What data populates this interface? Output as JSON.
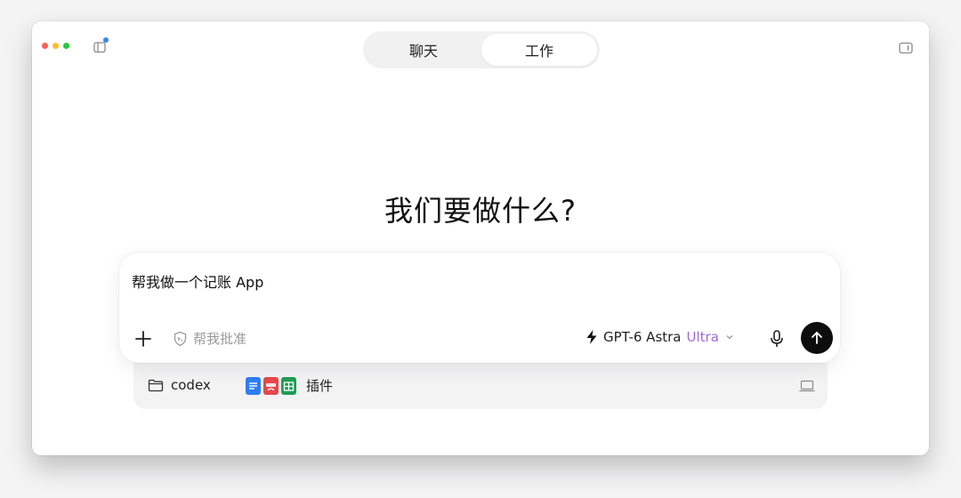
{
  "window": {
    "tabs": [
      {
        "label": "聊天",
        "active": false
      },
      {
        "label": "工作",
        "active": true
      }
    ]
  },
  "main": {
    "headline": "我们要做什么?"
  },
  "composer": {
    "input_value": "帮我做一个记账 App",
    "approve_label": "帮我批准",
    "model": {
      "name": "GPT-6 Astra",
      "tier": "Ultra"
    }
  },
  "context_bar": {
    "folder_label": "codex",
    "plugins_label": "插件",
    "plugin_icons": [
      "docs-icon",
      "pdf-icon",
      "sheets-icon"
    ]
  },
  "colors": {
    "accent_purple": "#9b6bd6",
    "notification_blue": "#3b82f6",
    "send_button": "#0d0d0d"
  }
}
